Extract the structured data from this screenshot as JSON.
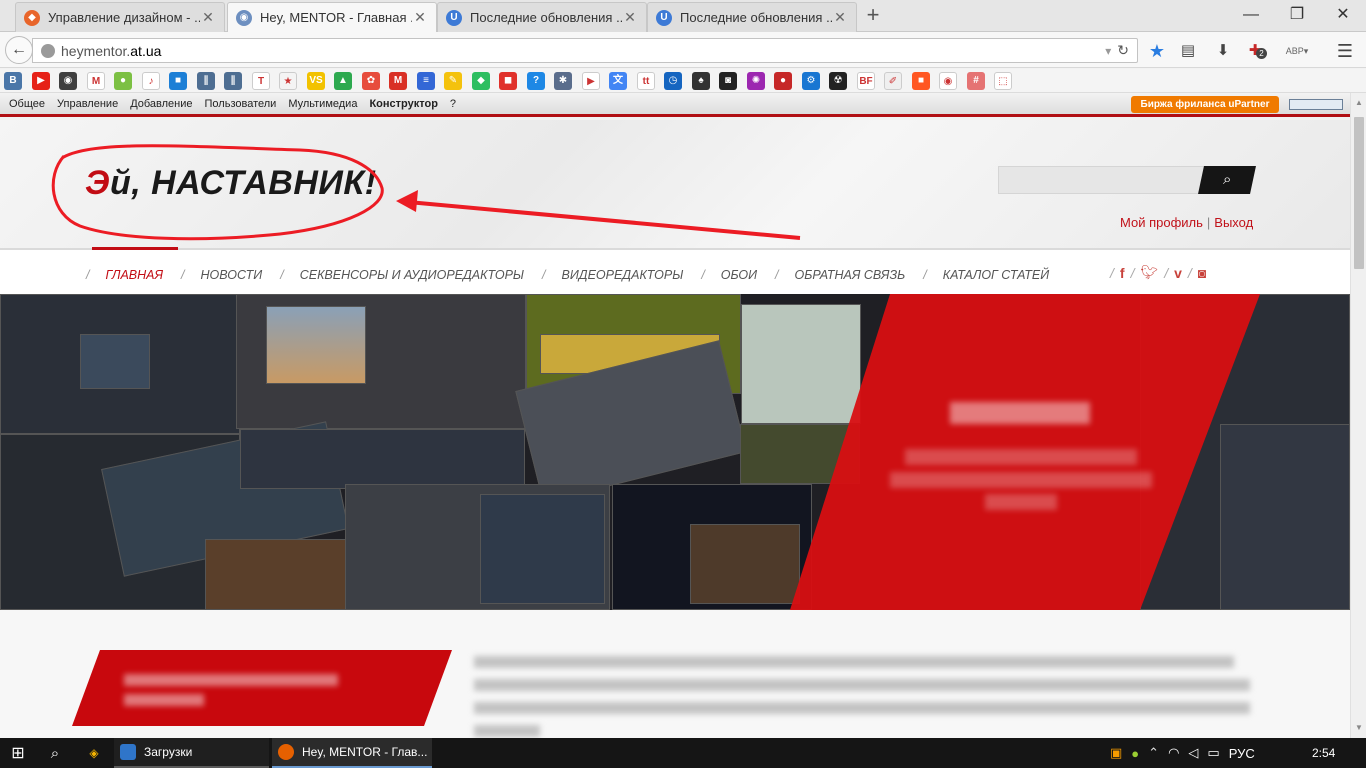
{
  "browser": {
    "tabs": [
      {
        "title": "Управление дизайном - ...",
        "icon": "ucoz-icon",
        "color": "#e8652b",
        "active": false
      },
      {
        "title": "Hey, MENTOR - Главная ...",
        "icon": "site-favicon-icon",
        "color": "#6d8fc0",
        "active": true
      },
      {
        "title": "Последние обновления ...",
        "icon": "ucoz-u-icon",
        "color": "#3d7ad6",
        "active": false
      },
      {
        "title": "Последние обновления ...",
        "icon": "ucoz-u-icon",
        "color": "#3d7ad6",
        "active": false
      }
    ],
    "new_tab_symbol": "+",
    "window_controls": {
      "minimize": "—",
      "maximize": "❐",
      "close": "✕"
    },
    "url_prefix": "heymentor.",
    "url_domain": "at.ua",
    "back_symbol": "←",
    "reload_symbol": "↻",
    "toolbar_icons": [
      "bookmark-star-icon",
      "reading-list-icon",
      "download-icon",
      "addon-icon",
      "translate-icon",
      "menu-icon"
    ],
    "addon_badge": "2",
    "translate_label": "АВР"
  },
  "bookmarks": [
    {
      "name": "vk-icon",
      "color": "#4a76a8",
      "glyph": "В"
    },
    {
      "name": "youtube-icon",
      "color": "#e62117",
      "glyph": "▶"
    },
    {
      "name": "instagram-icon",
      "color": "#3f3f3f",
      "glyph": "◉"
    },
    {
      "name": "gmail-icon",
      "color": "#ffffff",
      "glyph": "M"
    },
    {
      "name": "chat-icon",
      "color": "#7cc043",
      "glyph": "●"
    },
    {
      "name": "music-icon",
      "color": "#ffffff",
      "glyph": "♪"
    },
    {
      "name": "book-icon",
      "color": "#1c7fd6",
      "glyph": "■"
    },
    {
      "name": "pause-icon",
      "color": "#4e6e92",
      "glyph": "∥"
    },
    {
      "name": "pause2-icon",
      "color": "#4e6e92",
      "glyph": "∥"
    },
    {
      "name": "tumblr-icon",
      "color": "#ffffff",
      "glyph": "T"
    },
    {
      "name": "star-icon",
      "color": "#f4f4f4",
      "glyph": "★"
    },
    {
      "name": "vs-icon",
      "color": "#f2c200",
      "glyph": "VS"
    },
    {
      "name": "drive-icon",
      "color": "#2da94f",
      "glyph": "▲"
    },
    {
      "name": "dots-icon",
      "color": "#e74c3c",
      "glyph": "✿"
    },
    {
      "name": "m-icon",
      "color": "#d93025",
      "glyph": "M"
    },
    {
      "name": "doc-icon",
      "color": "#3367d6",
      "glyph": "≡"
    },
    {
      "name": "note-icon",
      "color": "#f4c20d",
      "glyph": "✎"
    },
    {
      "name": "evernote-icon",
      "color": "#2dbe60",
      "glyph": "◆"
    },
    {
      "name": "shield-icon",
      "color": "#e0312b",
      "glyph": "◼"
    },
    {
      "name": "help-icon",
      "color": "#1e88e5",
      "glyph": "?"
    },
    {
      "name": "gear-icon",
      "color": "#5a6d8c",
      "glyph": "✱"
    },
    {
      "name": "play-store-icon",
      "color": "#ffffff",
      "glyph": "▶"
    },
    {
      "name": "translate2-icon",
      "color": "#4285f4",
      "glyph": "文"
    },
    {
      "name": "tt-icon",
      "color": "#ffffff",
      "glyph": "tt"
    },
    {
      "name": "clock-icon",
      "color": "#1565c0",
      "glyph": "◷"
    },
    {
      "name": "spy-icon",
      "color": "#333333",
      "glyph": "♠"
    },
    {
      "name": "cube-icon",
      "color": "#222222",
      "glyph": "◙"
    },
    {
      "name": "colorwheel-icon",
      "color": "#9c27b0",
      "glyph": "✺"
    },
    {
      "name": "red-circle-icon",
      "color": "#c62828",
      "glyph": "●"
    },
    {
      "name": "settings2-icon",
      "color": "#1976d2",
      "glyph": "⚙"
    },
    {
      "name": "radiation-icon",
      "color": "#222222",
      "glyph": "☢"
    },
    {
      "name": "bf-icon",
      "color": "#ffffff",
      "glyph": "BF"
    },
    {
      "name": "edit-icon",
      "color": "#efefef",
      "glyph": "✐"
    },
    {
      "name": "orange-square-icon",
      "color": "#ff5722",
      "glyph": "■"
    },
    {
      "name": "eye-icon",
      "color": "#ffffff",
      "glyph": "◉"
    },
    {
      "name": "grid-icon",
      "color": "#e57373",
      "glyph": "#"
    },
    {
      "name": "select-icon",
      "color": "#ffffff",
      "glyph": "⬚"
    }
  ],
  "adminbar": {
    "items": [
      "Общее",
      "Управление",
      "Добавление",
      "Пользователи",
      "Мультимедиа",
      "Конструктор",
      "?"
    ],
    "upartner": "Биржа фриланса uPartner"
  },
  "site": {
    "logo_accent": "Э",
    "logo_rest": "й, НАСТАВНИК!",
    "search_icon": "search-icon",
    "profile_link": "Мой профиль",
    "profile_sep": "|",
    "logout_link": "Выход",
    "menu": [
      "ГЛАВНАЯ",
      "НОВОСТИ",
      "СЕКВЕНСОРЫ И АУДИОРЕДАКТОРЫ",
      "ВИДЕОРЕДАКТОРЫ",
      "ОБОИ",
      "ОБРАТНАЯ СВЯЗЬ",
      "КАТАЛОГ СТАТЕЙ"
    ],
    "menu_slash": "/",
    "social": [
      "facebook-icon",
      "twitter-icon",
      "vimeo-icon",
      "instagram-icon"
    ],
    "accent_color": "#c20c14"
  },
  "taskbar": {
    "apps": [
      {
        "label": "Загрузки",
        "icon": "downloads-folder-icon"
      },
      {
        "label": "Hey, MENTOR - Глав...",
        "icon": "firefox-icon"
      }
    ],
    "language": "РУС",
    "time": "2:54"
  }
}
